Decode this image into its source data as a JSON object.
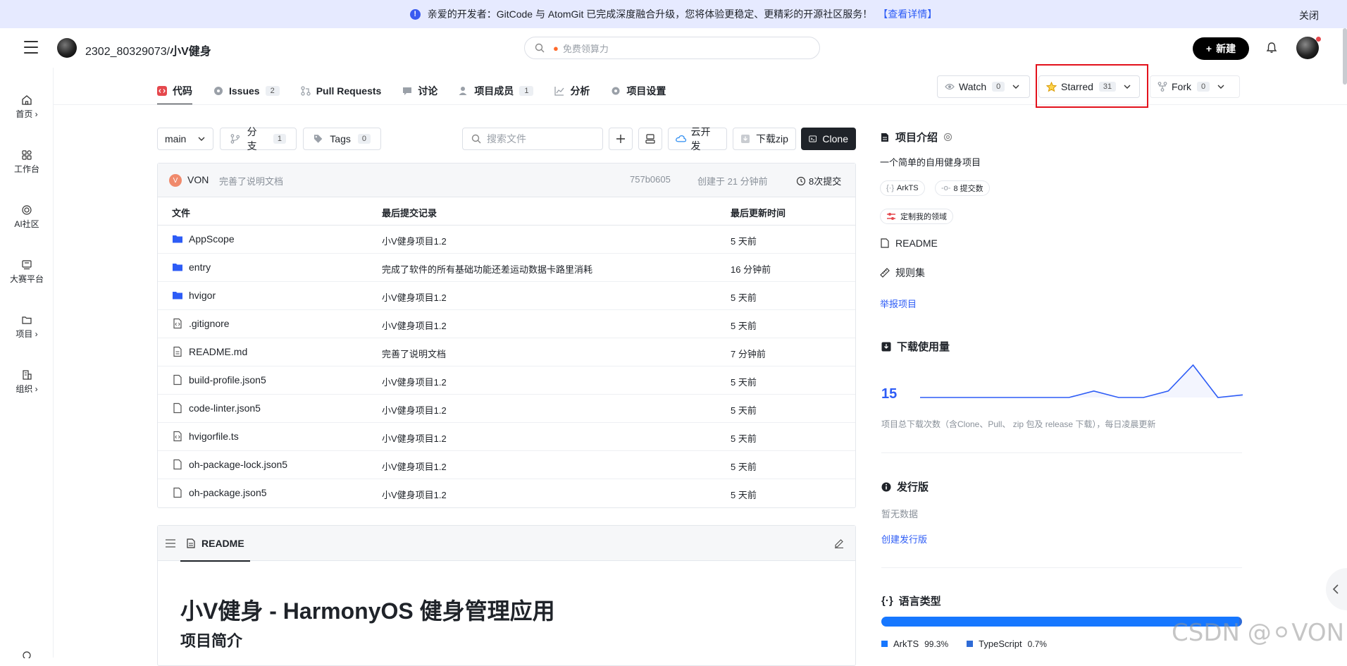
{
  "banner": {
    "text": "亲爱的开发者：GitCode 与 AtomGit 已完成深度融合升级，您将体验更稳定、更精彩的开源社区服务！",
    "link": "【查看详情】",
    "close": "关闭"
  },
  "header": {
    "owner": "2302_80329073/",
    "repo": "小V健身",
    "search_placeholder": "免费领算力",
    "new_label": "新建"
  },
  "sidebar": [
    {
      "label": "首页",
      "icon": "home-icon"
    },
    {
      "label": "工作台",
      "icon": "grid-icon"
    },
    {
      "label": "AI社区",
      "icon": "ai-icon"
    },
    {
      "label": "大赛平台",
      "icon": "trophy-icon"
    },
    {
      "label": "项目",
      "icon": "folder-icon"
    },
    {
      "label": "组织",
      "icon": "building-icon"
    }
  ],
  "tabs": [
    {
      "label": "代码",
      "count": ""
    },
    {
      "label": "Issues",
      "count": "2"
    },
    {
      "label": "Pull Requests",
      "count": ""
    },
    {
      "label": "讨论",
      "count": ""
    },
    {
      "label": "项目成员",
      "count": "1"
    },
    {
      "label": "分析",
      "count": ""
    },
    {
      "label": "项目设置",
      "count": ""
    }
  ],
  "repo_actions": {
    "watch": {
      "label": "Watch",
      "count": "0"
    },
    "star": {
      "label": "Starred",
      "count": "31"
    },
    "fork": {
      "label": "Fork",
      "count": "0"
    }
  },
  "toolbar": {
    "branch": "main",
    "branches_label": "分支",
    "branches_count": "1",
    "tags_label": "Tags",
    "tags_count": "0",
    "file_search_placeholder": "搜索文件",
    "cloud_label": "云开发",
    "download_label": "下载zip",
    "clone_label": "Clone"
  },
  "last_commit": {
    "avatar_letter": "V",
    "author": "VON",
    "message": "完善了说明文档",
    "hash": "757b0605",
    "time": "创建于 21 分钟前",
    "count": "8次提交"
  },
  "table": {
    "headers": [
      "文件",
      "最后提交记录",
      "最后更新时间"
    ],
    "rows": [
      {
        "name": "AppScope",
        "type": "folder",
        "commit": "小V健身项目1.2",
        "time": "5 天前"
      },
      {
        "name": "entry",
        "type": "folder",
        "commit": "完成了软件的所有基础功能还差运动数据卡路里消耗",
        "time": "16 分钟前"
      },
      {
        "name": "hvigor",
        "type": "folder",
        "commit": "小V健身项目1.2",
        "time": "5 天前"
      },
      {
        "name": ".gitignore",
        "type": "code",
        "commit": "小V健身项目1.2",
        "time": "5 天前"
      },
      {
        "name": "README.md",
        "type": "doc",
        "commit": "完善了说明文档",
        "time": "7 分钟前"
      },
      {
        "name": "build-profile.json5",
        "type": "file",
        "commit": "小V健身项目1.2",
        "time": "5 天前"
      },
      {
        "name": "code-linter.json5",
        "type": "file",
        "commit": "小V健身项目1.2",
        "time": "5 天前"
      },
      {
        "name": "hvigorfile.ts",
        "type": "code",
        "commit": "小V健身项目1.2",
        "time": "5 天前"
      },
      {
        "name": "oh-package-lock.json5",
        "type": "file",
        "commit": "小V健身项目1.2",
        "time": "5 天前"
      },
      {
        "name": "oh-package.json5",
        "type": "file",
        "commit": "小V健身项目1.2",
        "time": "5 天前"
      }
    ]
  },
  "readme": {
    "tab": "README",
    "h1": "小V健身 - HarmonyOS 健身管理应用",
    "h2": "项目简介"
  },
  "about": {
    "title": "项目介绍",
    "description": "一个简单的自用健身项目",
    "lang_chip": "ArkTS",
    "commits_chip": "8 提交数",
    "custom_chip": "定制我的领域",
    "readme_link": "README",
    "rules_link": "规则集",
    "report_link": "举报项目"
  },
  "downloads": {
    "title": "下载使用量",
    "total": "15",
    "note": "项目总下载次数（含Clone、Pull、 zip 包及 release 下载），每日凌晨更新",
    "series": [
      0,
      0,
      0,
      0,
      0,
      0,
      0,
      1,
      0,
      0,
      1,
      5,
      0,
      0.4
    ]
  },
  "releases": {
    "title": "发行版",
    "empty": "暂无数据",
    "create": "创建发行版"
  },
  "languages": {
    "title": "语言类型",
    "items": [
      {
        "name": "ArkTS",
        "percent": "99.3%",
        "value": 99.3,
        "color": "#1677ff"
      },
      {
        "name": "TypeScript",
        "percent": "0.7%",
        "value": 0.7,
        "color": "#2f6bd6"
      }
    ]
  },
  "watermark": "CSDN @⚪VON"
}
